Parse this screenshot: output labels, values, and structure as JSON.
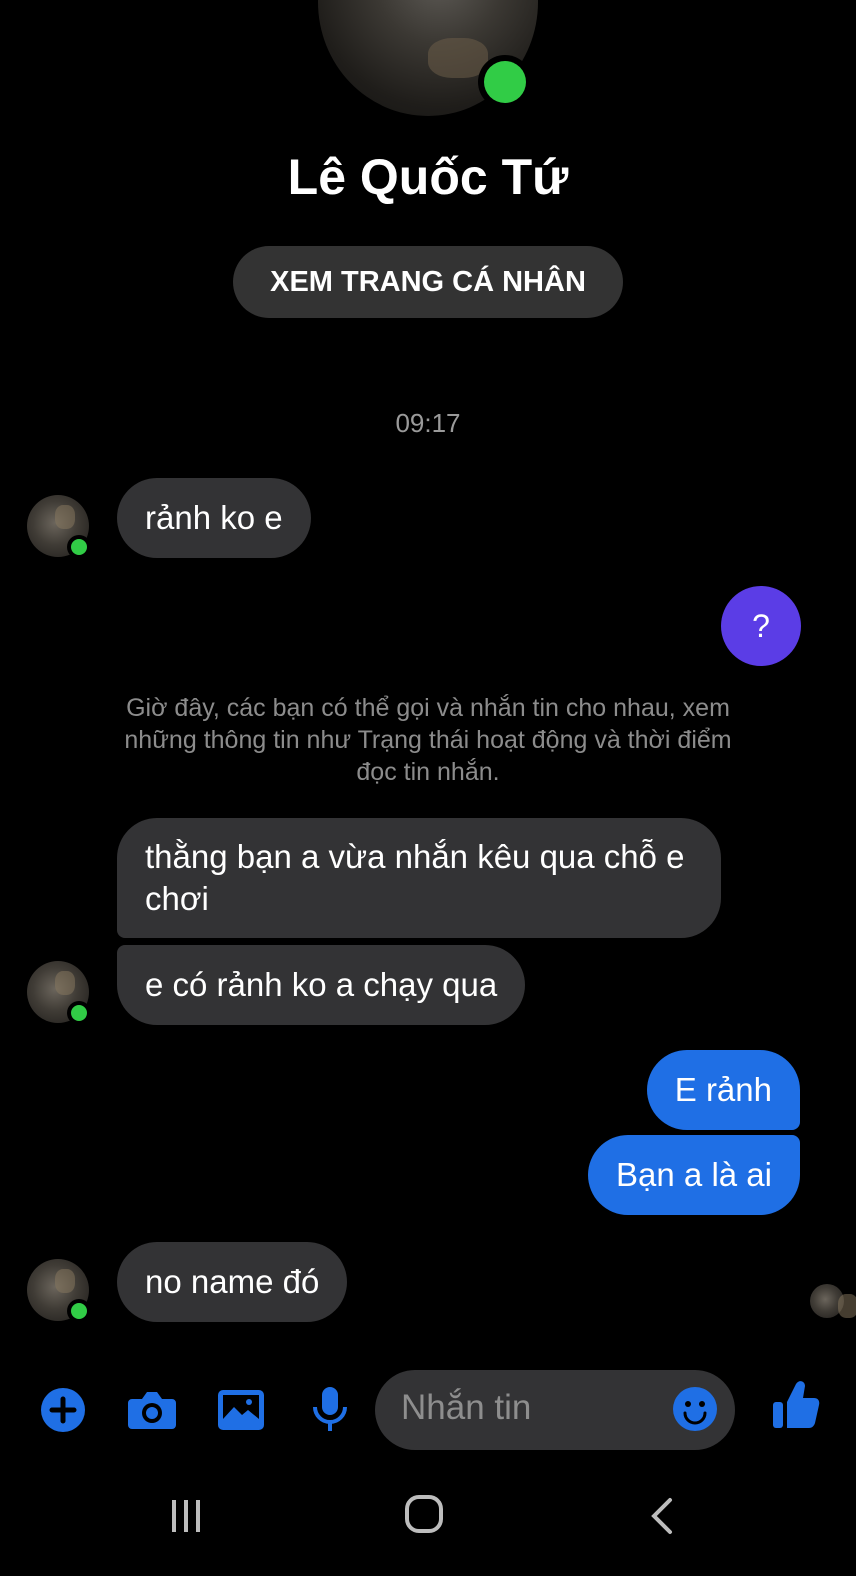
{
  "contact": {
    "name": "Lê Quốc Tứ",
    "view_profile_label": "XEM TRANG CÁ NHÂN",
    "online": true
  },
  "timestamp": "09:17",
  "system_notice": "Giờ đây, các bạn có thể gọi và nhắn tin cho nhau, xem những thông tin như Trạng thái hoạt động và thời điểm đọc tin nhắn.",
  "question_button_label": "?",
  "messages": [
    {
      "from": "contact",
      "text": "rảnh ko e"
    },
    {
      "from": "contact",
      "text": "thằng bạn a vừa nhắn kêu qua chỗ e chơi"
    },
    {
      "from": "contact",
      "text": "e có rảnh ko a chạy qua"
    },
    {
      "from": "me",
      "text": "E rảnh"
    },
    {
      "from": "me",
      "text": "Bạn a là ai"
    },
    {
      "from": "contact",
      "text": "no name đó"
    }
  ],
  "composer": {
    "placeholder": "Nhắn tin",
    "icons": [
      "plus-icon",
      "camera-icon",
      "gallery-icon",
      "microphone-icon",
      "emoji-icon",
      "thumbs-up-icon"
    ]
  },
  "colors": {
    "accent": "#1f6fe5",
    "incoming_bubble": "#333335",
    "online": "#31cc46",
    "question_button": "#5b3de6"
  },
  "navbar": {
    "icons": [
      "recent-apps-icon",
      "home-icon",
      "back-icon"
    ]
  }
}
